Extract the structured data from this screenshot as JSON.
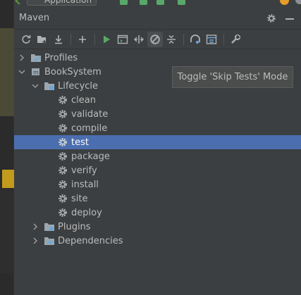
{
  "top_toolbar": {
    "run_config_label": "Application"
  },
  "panel": {
    "title": "Maven"
  },
  "toolbar": {
    "buttons": [
      "reload-all-icon",
      "generate-sources-icon",
      "download-icon",
      "add-icon",
      "run-icon",
      "execute-goal-icon",
      "toggle-offline-icon",
      "skip-tests-icon",
      "collapse-icon",
      "analyze-dependencies-icon",
      "show-dependencies-icon",
      "settings-wrench-icon"
    ],
    "active": "skip-tests-icon"
  },
  "tooltip": {
    "text": "Toggle 'Skip Tests' Mode"
  },
  "tree": {
    "profiles": "Profiles",
    "project": "BookSystem",
    "lifecycle": "Lifecycle",
    "goals": [
      "clean",
      "validate",
      "compile",
      "test",
      "package",
      "verify",
      "install",
      "site",
      "deploy"
    ],
    "selected_goal": "test",
    "plugins": "Plugins",
    "dependencies": "Dependencies"
  },
  "colors": {
    "panel_bg": "#3c3f41",
    "selection": "#4b6eaf",
    "run_green": "#59a869",
    "icon_grey": "#afb1b3",
    "folder_blue": "#6aa5d8"
  }
}
